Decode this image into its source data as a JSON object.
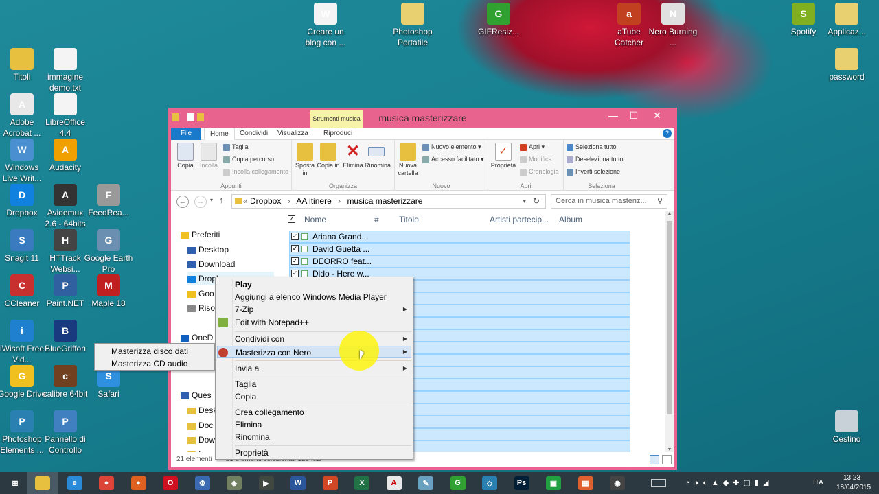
{
  "desktop": {
    "icons": [
      {
        "label": "Titoli",
        "color": "#e8c040",
        "glyph": ""
      },
      {
        "label": "immagine demo.txt",
        "color": "#f4f4f4",
        "glyph": ""
      },
      {
        "label": "Adobe Acrobat ...",
        "color": "#e8e8e8",
        "glyph": "A"
      },
      {
        "label": "LibreOffice 4.4",
        "color": "#f4f4f4",
        "glyph": ""
      },
      {
        "label": "Windows Live Writ...",
        "color": "#4a8fd0",
        "glyph": "W"
      },
      {
        "label": "Audacity",
        "color": "#f0a000",
        "glyph": "A"
      },
      {
        "label": "Dropbox",
        "color": "#1081de",
        "glyph": "D"
      },
      {
        "label": "Avidemux 2.6 - 64bits",
        "color": "#333",
        "glyph": "A"
      },
      {
        "label": "FeedRea...",
        "color": "#999",
        "glyph": "F"
      },
      {
        "label": "Snagit 11",
        "color": "#3a7bbf",
        "glyph": "S"
      },
      {
        "label": "HTTrack Websi...",
        "color": "#444",
        "glyph": "H"
      },
      {
        "label": "Google Earth Pro",
        "color": "#6a8fb0",
        "glyph": "G"
      },
      {
        "label": "CCleaner",
        "color": "#c83030",
        "glyph": "C"
      },
      {
        "label": "Paint.NET",
        "color": "#3060a0",
        "glyph": "P"
      },
      {
        "label": "Maple 18",
        "color": "#c02020",
        "glyph": "M"
      },
      {
        "label": "iWisoft Free Vid...",
        "color": "#2080d0",
        "glyph": "i"
      },
      {
        "label": "BlueGriffon",
        "color": "#1a3a80",
        "glyph": "B"
      },
      {
        "label": "Google Drive",
        "color": "#f0c020",
        "glyph": "G"
      },
      {
        "label": "calibre 64bit",
        "color": "#704020",
        "glyph": "c"
      },
      {
        "label": "Safari",
        "color": "#3090e0",
        "glyph": "S"
      },
      {
        "label": "Photoshop Elements ...",
        "color": "#2a80b0",
        "glyph": "P"
      },
      {
        "label": "Pannello di Controllo",
        "color": "#4080c0",
        "glyph": "P"
      },
      {
        "label": "Creare un blog con ...",
        "color": "#f4f4f4",
        "glyph": "W"
      },
      {
        "label": "Photoshop Portatile",
        "color": "#e8d070",
        "glyph": ""
      },
      {
        "label": "GIFResiz...",
        "color": "#30a030",
        "glyph": "G"
      },
      {
        "label": "aTube Catcher",
        "color": "#c04020",
        "glyph": "a"
      },
      {
        "label": "Nero Burning ...",
        "color": "#e0e0e0",
        "glyph": "N"
      },
      {
        "label": "Spotify",
        "color": "#80b020",
        "glyph": "S"
      },
      {
        "label": "Applicaz...",
        "color": "#e8d070",
        "glyph": ""
      },
      {
        "label": "password",
        "color": "#e8d070",
        "glyph": ""
      },
      {
        "label": "Cestino",
        "color": "#c8d0d8",
        "glyph": ""
      }
    ]
  },
  "window": {
    "title": "musica masterizzare",
    "context_tab_header": "Strumenti musica",
    "tabs": [
      "File",
      "Home",
      "Condividi",
      "Visualizza",
      "Riproduci"
    ],
    "ribbon": {
      "copia": "Copia",
      "incolla": "Incolla",
      "taglia": "Taglia",
      "copia_percorso": "Copia percorso",
      "incolla_collegamento": "Incolla collegamento",
      "group_appunti": "Appunti",
      "sposta_in": "Sposta in",
      "copia_in": "Copia in",
      "elimina": "Elimina",
      "rinomina": "Rinomina",
      "group_organizza": "Organizza",
      "nuova_cartella": "Nuova cartella",
      "nuovo_elemento": "Nuovo elemento",
      "accesso_facilitato": "Accesso facilitato",
      "group_nuovo": "Nuovo",
      "proprieta": "Proprietà",
      "apri": "Apri",
      "modifica": "Modifica",
      "cronologia": "Cronologia",
      "group_apri": "Apri",
      "seleziona_tutto": "Seleziona tutto",
      "deseleziona_tutto": "Deseleziona tutto",
      "inverti_selezione": "Inverti selezione",
      "group_seleziona": "Seleziona"
    },
    "address": {
      "path": [
        "Dropbox",
        "AA itinere",
        "musica masterizzare"
      ],
      "search_placeholder": "Cerca in musica masteriz..."
    },
    "nav": {
      "items": [
        "Preferiti",
        "Desktop",
        "Download",
        "Dropbox",
        "Goo",
        "Riso",
        "OneD",
        "Ques",
        "Desk",
        "Doc",
        "Dow",
        "Imm"
      ]
    },
    "columns": [
      "Nome",
      "#",
      "Titolo",
      "Artisti partecip...",
      "Album"
    ],
    "files": [
      "Ariana Grand...",
      "David Guetta ...",
      "DEORRO feat...",
      "Dido - Here w..."
    ],
    "status": {
      "count": "21 elementi",
      "selected": "21 elementi selezionati  126 MB"
    }
  },
  "context_menu": {
    "items": [
      "Play",
      "Aggiungi a elenco Windows Media Player",
      "7-Zip",
      "Edit with Notepad++",
      "Condividi con",
      "Masterizza con Nero",
      "Invia a",
      "Taglia",
      "Copia",
      "Crea collegamento",
      "Elimina",
      "Rinomina",
      "Proprietà"
    ],
    "submenu": [
      "Masterizza disco dati",
      "Masterizza CD audio"
    ]
  },
  "taskbar": {
    "apps": [
      {
        "name": "windows-start",
        "color": "#2c3940",
        "glyph": "⊞"
      },
      {
        "name": "file-explorer",
        "color": "#e8c040",
        "glyph": ""
      },
      {
        "name": "internet-explorer",
        "color": "#2a8ad8",
        "glyph": "e"
      },
      {
        "name": "chrome",
        "color": "#db4437",
        "glyph": "●"
      },
      {
        "name": "firefox",
        "color": "#e06020",
        "glyph": "●"
      },
      {
        "name": "opera",
        "color": "#d01020",
        "glyph": "O"
      },
      {
        "name": "settings-tool",
        "color": "#3a6ab0",
        "glyph": "⚙"
      },
      {
        "name": "burning-app",
        "color": "#708060",
        "glyph": "◈"
      },
      {
        "name": "terminal",
        "color": "#404840",
        "glyph": "▶"
      },
      {
        "name": "word",
        "color": "#2b579a",
        "glyph": "W"
      },
      {
        "name": "powerpoint",
        "color": "#d24726",
        "glyph": "P"
      },
      {
        "name": "excel",
        "color": "#217346",
        "glyph": "X"
      },
      {
        "name": "acrobat",
        "color": "#e8e8e8",
        "glyph": "A"
      },
      {
        "name": "notes",
        "color": "#6aa0c0",
        "glyph": "✎"
      },
      {
        "name": "gif-tool",
        "color": "#30a030",
        "glyph": "G"
      },
      {
        "name": "photoshop-elements",
        "color": "#2a80b0",
        "glyph": "◇"
      },
      {
        "name": "photoshop",
        "color": "#001e36",
        "glyph": "Ps"
      },
      {
        "name": "sway",
        "color": "#20a040",
        "glyph": "▣"
      },
      {
        "name": "app-grid",
        "color": "#e06030",
        "glyph": "▦"
      },
      {
        "name": "webcam",
        "color": "#444",
        "glyph": "◉"
      }
    ],
    "lang": "ITA",
    "time": "13:23",
    "date": "18/04/2015"
  }
}
